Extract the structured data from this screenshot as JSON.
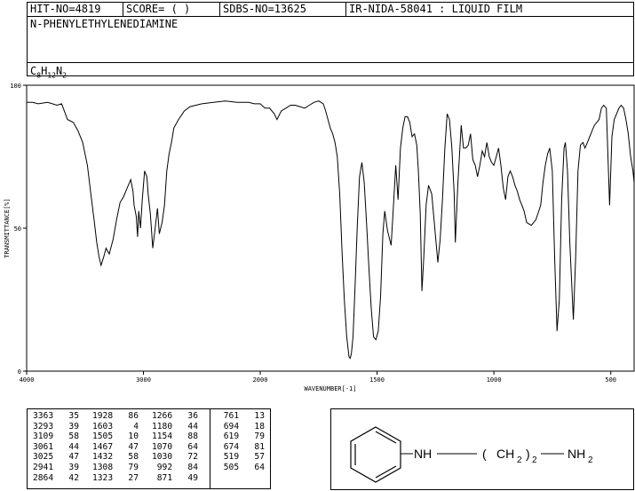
{
  "header": {
    "hit_no": "HIT-NO=4819",
    "score": "SCORE=  (   )",
    "sdbs_no": "SDBS-NO=13625",
    "ir_info": "IR-NIDA-58041 : LIQUID FILM",
    "compound_name": "N-PHENYLETHYLENEDIAMINE",
    "formula_parts": [
      "C",
      "8",
      "H",
      "12",
      "N",
      "2"
    ]
  },
  "chart_data": {
    "type": "line",
    "xlabel": "WAVENUMBER[-1]",
    "ylabel": "TRANSMITTANCE[%]",
    "x_ticks": [
      "4000",
      "3000",
      "2000",
      "1500",
      "1000",
      "500"
    ],
    "y_ticks": [
      "100",
      "50",
      "0"
    ],
    "xlim": [
      4000,
      400
    ],
    "ylim": [
      0,
      100
    ],
    "grid": false,
    "series": [
      {
        "x": [
          4000,
          3950,
          3900,
          3820,
          3740,
          3700,
          3650,
          3600,
          3560,
          3520,
          3480,
          3450,
          3420,
          3400,
          3380,
          3363,
          3340,
          3320,
          3293,
          3260,
          3230,
          3200,
          3170,
          3140,
          3109,
          3090,
          3080,
          3061,
          3050,
          3040,
          3025,
          3010,
          2990,
          2970,
          2960,
          2941,
          2920,
          2900,
          2880,
          2864,
          2840,
          2820,
          2800,
          2780,
          2760,
          2740,
          2700,
          2650,
          2600,
          2550,
          2500,
          2400,
          2300,
          2200,
          2100,
          2050,
          2000,
          1980,
          1960,
          1940,
          1928,
          1910,
          1890,
          1870,
          1850,
          1830,
          1810,
          1790,
          1770,
          1750,
          1730,
          1720,
          1710,
          1700,
          1690,
          1680,
          1670,
          1660,
          1650,
          1640,
          1630,
          1620,
          1615,
          1610,
          1603,
          1595,
          1585,
          1575,
          1565,
          1555,
          1545,
          1535,
          1525,
          1515,
          1505,
          1495,
          1485,
          1475,
          1467,
          1455,
          1440,
          1432,
          1420,
          1410,
          1400,
          1390,
          1380,
          1370,
          1360,
          1350,
          1340,
          1330,
          1323,
          1315,
          1308,
          1300,
          1290,
          1280,
          1266,
          1255,
          1240,
          1230,
          1220,
          1210,
          1200,
          1190,
          1180,
          1170,
          1165,
          1154,
          1140,
          1130,
          1120,
          1110,
          1100,
          1090,
          1080,
          1070,
          1060,
          1050,
          1040,
          1030,
          1020,
          1010,
          1000,
          990,
          980,
          970,
          960,
          950,
          940,
          930,
          920,
          910,
          900,
          890,
          880,
          871,
          860,
          840,
          820,
          800,
          790,
          780,
          770,
          761,
          750,
          740,
          730,
          720,
          710,
          700,
          694,
          685,
          675,
          660,
          650,
          640,
          630,
          619,
          610,
          600,
          590,
          580,
          570,
          560,
          550,
          540,
          530,
          519,
          505,
          495,
          485,
          475,
          465,
          455,
          445,
          435,
          425,
          415,
          405,
          400
        ],
        "y": [
          94,
          94,
          93.5,
          94,
          93,
          93.5,
          88,
          87,
          84,
          80,
          72,
          62,
          52,
          45,
          40,
          37,
          40,
          43,
          41,
          46,
          53,
          59,
          61,
          64,
          67,
          63,
          58,
          54,
          47,
          56,
          50,
          60,
          70,
          68,
          62,
          55,
          43,
          50,
          57,
          48,
          52,
          58,
          70,
          76,
          80,
          85,
          88,
          91,
          92.5,
          93,
          93.5,
          94,
          94.5,
          94,
          94,
          93.5,
          93.5,
          92,
          92,
          90,
          88,
          91,
          92,
          93,
          93,
          92.5,
          92,
          93,
          94,
          94.5,
          93.5,
          91,
          88,
          85,
          83,
          80,
          75,
          62,
          42,
          25,
          12,
          5,
          4.5,
          6,
          12,
          28,
          50,
          68,
          73,
          66,
          52,
          36,
          22,
          12,
          11,
          14,
          26,
          48,
          56,
          49,
          44,
          55,
          72,
          60,
          78,
          85,
          89,
          89,
          87,
          82,
          83,
          79,
          70,
          55,
          28,
          40,
          58,
          65,
          62,
          52,
          38,
          46,
          60,
          78,
          90,
          88,
          78,
          62,
          45,
          66,
          86,
          78,
          78,
          79,
          83,
          74,
          72,
          68,
          72,
          77,
          75,
          80,
          75,
          73,
          72,
          75,
          78,
          72,
          64,
          60,
          68,
          70,
          68,
          65,
          63,
          60,
          58,
          56,
          52,
          51,
          53,
          58,
          66,
          72,
          76,
          78,
          70,
          40,
          14,
          25,
          60,
          78,
          80,
          70,
          45,
          18,
          40,
          70,
          79,
          80,
          78,
          80,
          82,
          84,
          86,
          87,
          88,
          92,
          93,
          92,
          58,
          82,
          88,
          90,
          92,
          93,
          92,
          88,
          83,
          75,
          70,
          66
        ]
      }
    ]
  },
  "peak_table": [
    {
      "wn": [
        "3363",
        "3293",
        "3109",
        "3061",
        "3025",
        "2941",
        "2864"
      ],
      "t": [
        "35",
        "39",
        "58",
        "44",
        "47",
        "39",
        "42"
      ]
    },
    {
      "wn": [
        "1928",
        "1603",
        "1505",
        "1467",
        "1432",
        "1308",
        "1323"
      ],
      "t": [
        "86",
        "4",
        "10",
        "47",
        "58",
        "79",
        "27"
      ]
    },
    {
      "wn": [
        "1266",
        "1180",
        "1154",
        "1070",
        "1030",
        "992",
        "871"
      ],
      "t": [
        "36",
        "44",
        "88",
        "64",
        "72",
        "84",
        "49"
      ]
    },
    {
      "wn": [
        "761",
        "694",
        "619",
        "674",
        "519",
        "505"
      ],
      "t": [
        "13",
        "18",
        "79",
        "81",
        "57",
        "64"
      ]
    }
  ],
  "structure": {
    "nh": "NH",
    "chain_open": "(",
    "chain_ch": "CH",
    "chain_sub": "2",
    "chain_close": ")",
    "chain_n": "2",
    "nh2": "NH",
    "nh2_sub": "2"
  }
}
